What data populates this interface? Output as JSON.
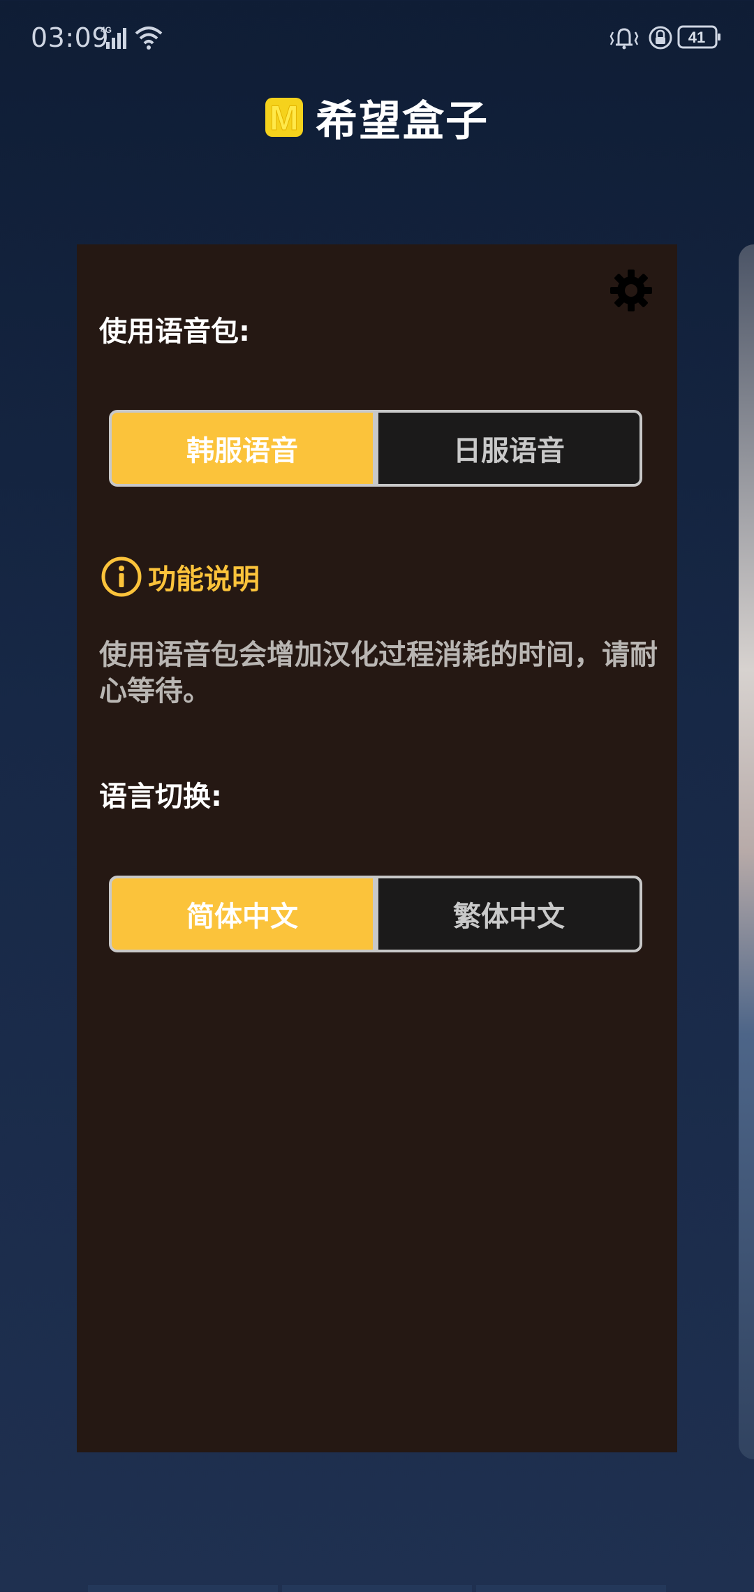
{
  "status_bar": {
    "time": "03:09",
    "network": "4G",
    "battery": "41"
  },
  "header": {
    "logo_letter": "M",
    "title": "希望盒子"
  },
  "panel": {
    "voice_section": {
      "label": "使用语音包:",
      "options": [
        "韩服语音",
        "日服语音"
      ],
      "selected": "韩服语音"
    },
    "info": {
      "title": "功能说明",
      "description": "使用语音包会增加汉化过程消耗的时间，请耐心等待。"
    },
    "language_section": {
      "label": "语言切换:",
      "options": [
        "简体中文",
        "繁体中文"
      ],
      "selected": "简体中文"
    }
  },
  "colors": {
    "accent": "#fbc33b",
    "panel_bg": "#251813",
    "page_bg": "#172846"
  },
  "icons": {
    "settings": "gear-icon",
    "info": "info-circle-icon",
    "signal": "signal-icon",
    "wifi": "wifi-icon",
    "vibrate": "vibrate-icon",
    "lock": "lock-icon",
    "battery": "battery-icon"
  }
}
